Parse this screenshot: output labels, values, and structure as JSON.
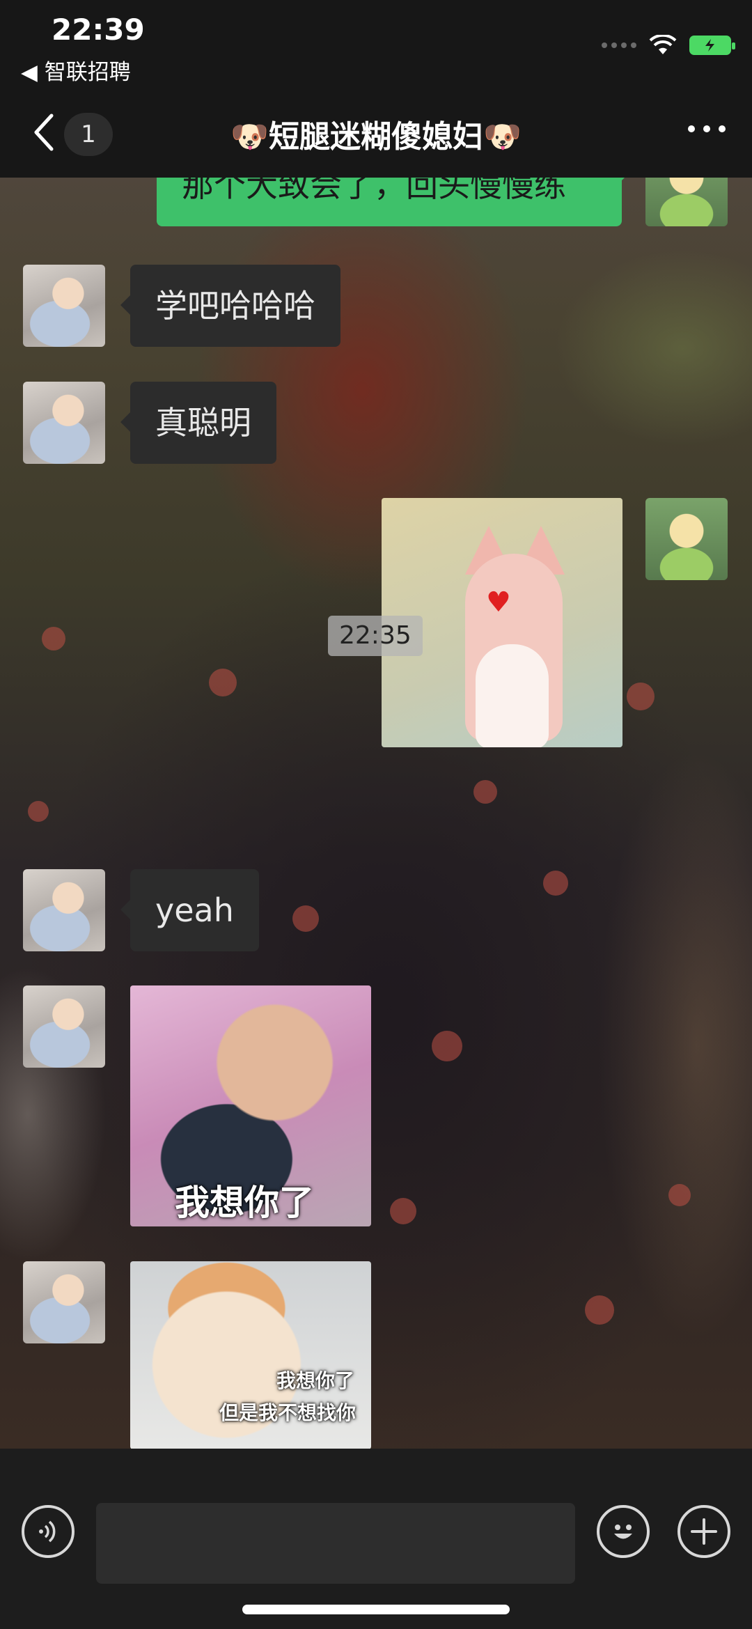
{
  "status_bar": {
    "time": "22:39",
    "back_app": "◀ 智联招聘",
    "battery_color": "#4cd964"
  },
  "nav": {
    "back_icon": "chevron-left-icon",
    "unread_count": "1",
    "title": "🐶短腿迷糊傻媳妇🐶",
    "more_icon": "more-dots-icon"
  },
  "messages": [
    {
      "side": "right",
      "type": "text",
      "text": "那个大致会了，回头慢慢练"
    },
    {
      "side": "left",
      "type": "text",
      "text": "学吧哈哈哈"
    },
    {
      "side": "left",
      "type": "text",
      "text": "真聪明"
    },
    {
      "side": "right",
      "type": "sticker",
      "icon": "fox-sticker"
    },
    {
      "type": "timestamp",
      "text": "22:35"
    },
    {
      "side": "left",
      "type": "text",
      "text": "yeah"
    },
    {
      "side": "left",
      "type": "sticker",
      "icon": "lady-sticker",
      "caption": "我想你了"
    },
    {
      "side": "left",
      "type": "sticker",
      "icon": "cat-sticker",
      "caption_lines": [
        "我想你了",
        "但是我不想找你"
      ]
    }
  ],
  "input_bar": {
    "voice_icon": "voice-icon",
    "input_value": "",
    "emoji_icon": "emoji-icon",
    "plus_icon": "plus-icon"
  },
  "colors": {
    "bubble_me": "#3ec16a",
    "bubble_other": "#2c2c2c",
    "bar_bg": "#171717"
  }
}
